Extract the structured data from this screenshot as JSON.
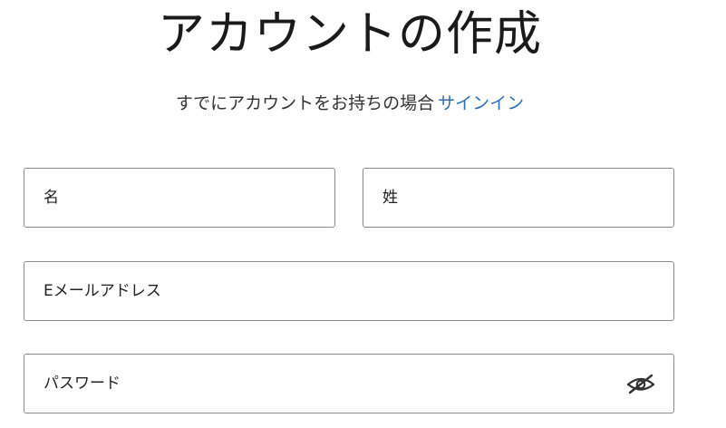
{
  "header": {
    "title": "アカウントの作成",
    "subtitle_text": "すでにアカウントをお持ちの場合",
    "signin_link": "サインイン"
  },
  "form": {
    "first_name": {
      "placeholder": "名",
      "value": ""
    },
    "last_name": {
      "placeholder": "姓",
      "value": ""
    },
    "email": {
      "placeholder": "Eメールアドレス",
      "value": ""
    },
    "password": {
      "placeholder": "パスワード",
      "value": "",
      "visibility_icon": "eye-slash-icon"
    }
  },
  "colors": {
    "link": "#2f6fb5",
    "border": "#8a8a8a",
    "text": "#1f1f1f"
  }
}
